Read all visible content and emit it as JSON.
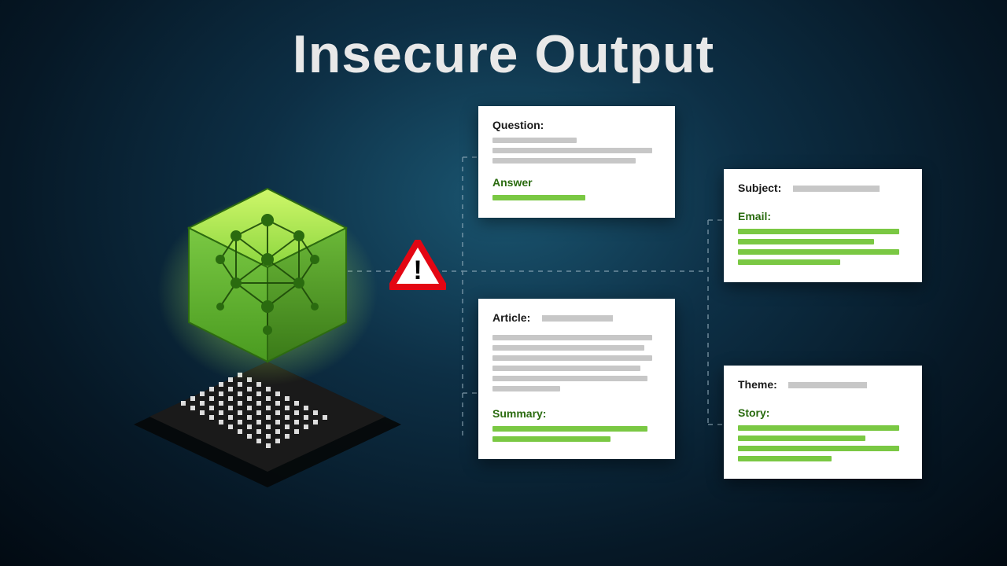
{
  "title": "Insecure Output",
  "warning_icon": "warning-triangle",
  "model_icon": "ai-neural-cube",
  "cards": {
    "qa": {
      "label_q": "Question:",
      "label_a": "Answer"
    },
    "email": {
      "label_subject": "Subject:",
      "label_email": "Email:"
    },
    "article": {
      "label_article": "Article:",
      "label_summary": "Summary:"
    },
    "story": {
      "label_theme": "Theme:",
      "label_story": "Story:"
    }
  },
  "colors": {
    "accent_green": "#7ac843",
    "warn_red": "#e30613",
    "placeholder_gray": "#c7c7c7"
  }
}
